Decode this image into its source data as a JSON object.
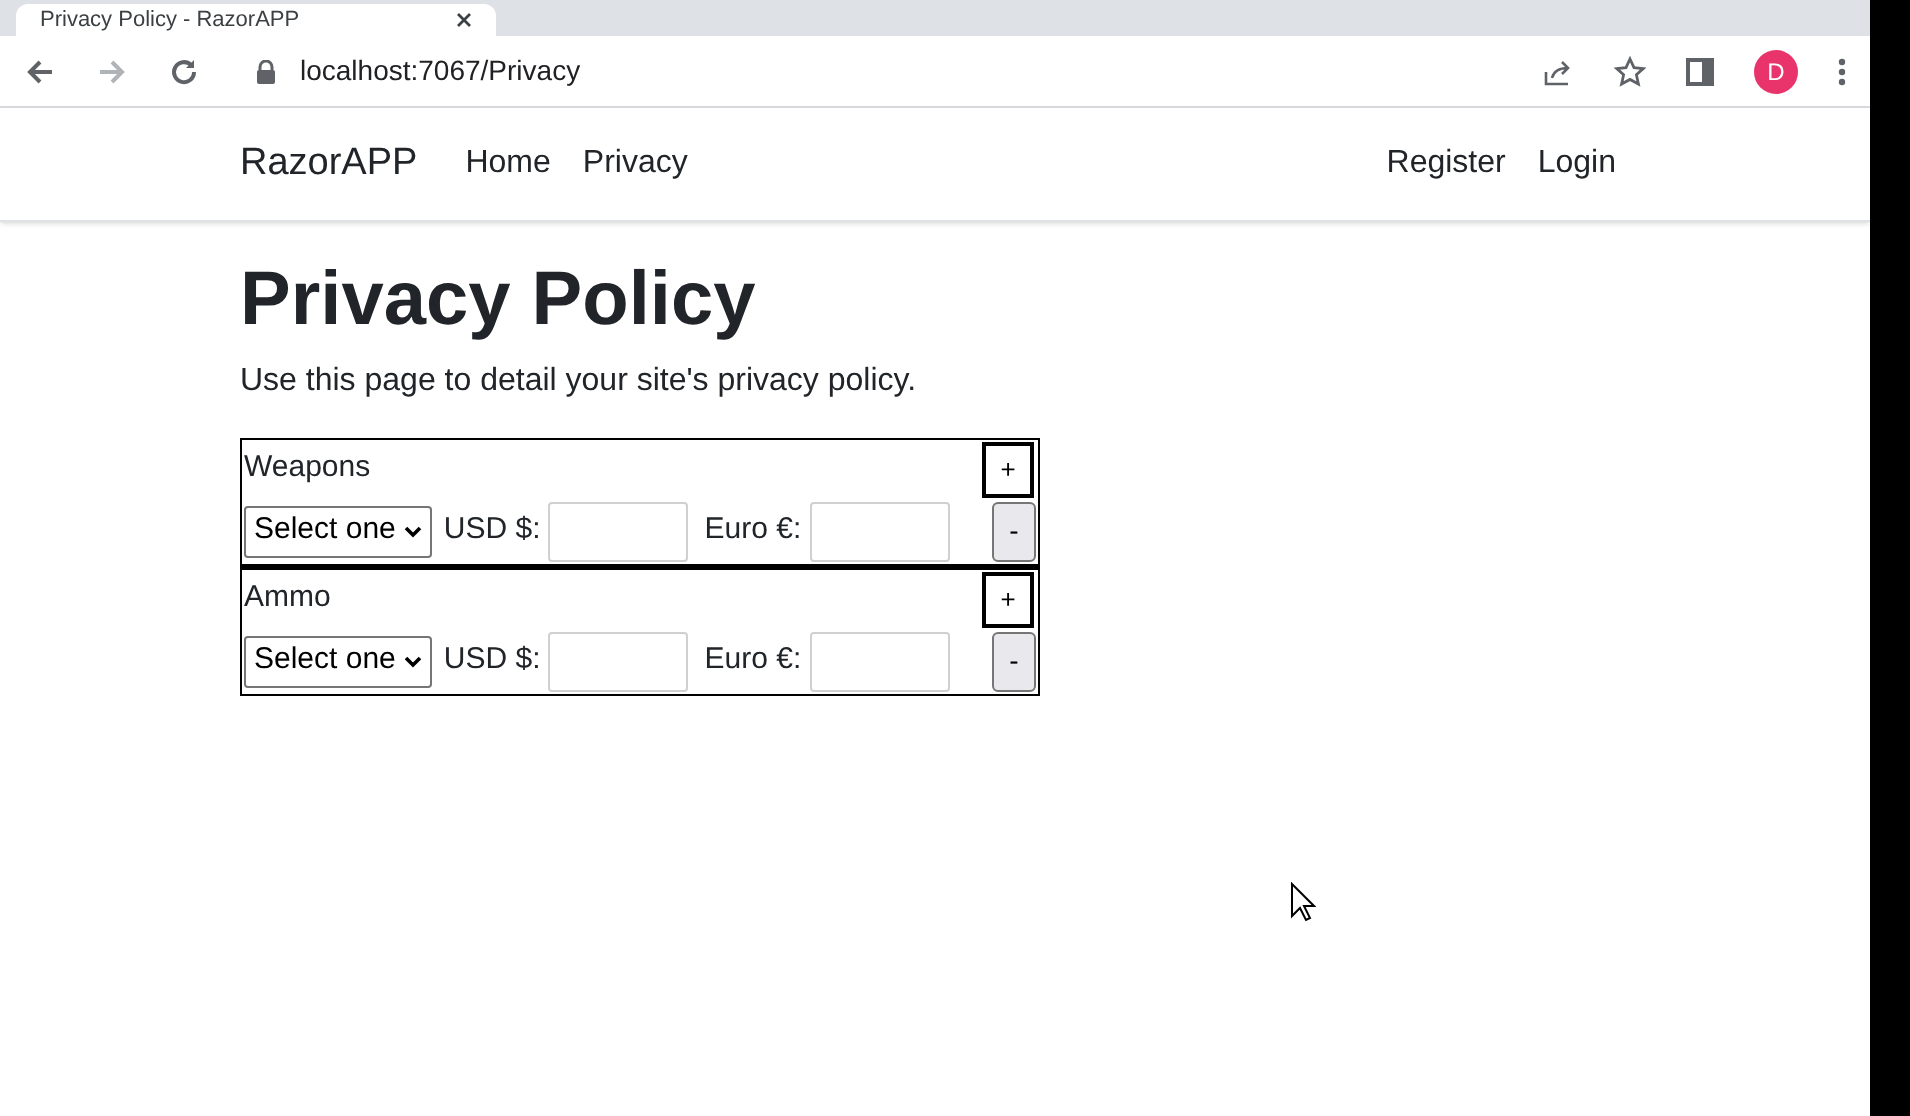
{
  "browser": {
    "tab_title": "Privacy Policy - RazorAPP",
    "url": "localhost:7067/Privacy",
    "profile_initial": "D"
  },
  "navbar": {
    "brand": "RazorAPP",
    "left_links": [
      "Home",
      "Privacy"
    ],
    "right_links": [
      "Register",
      "Login"
    ]
  },
  "heading": "Privacy Policy",
  "intro": "Use this page to detail your site's privacy policy.",
  "groups": [
    {
      "title": "Weapons",
      "add": "+",
      "select": "Select one",
      "usd_label": "USD $:",
      "euro_label": "Euro €:",
      "remove": "-"
    },
    {
      "title": "Ammo",
      "add": "+",
      "select": "Select one",
      "usd_label": "USD $:",
      "euro_label": "Euro €:",
      "remove": "-"
    }
  ]
}
